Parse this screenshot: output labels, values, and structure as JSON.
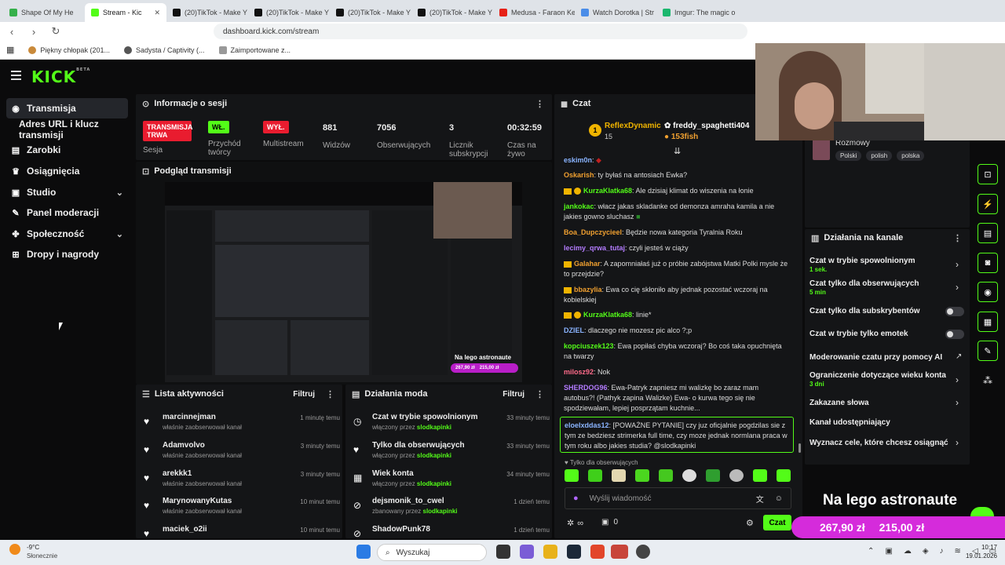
{
  "browser": {
    "tabs": [
      {
        "title": "Shape Of My He",
        "color": "#35b04a"
      },
      {
        "title": "Stream - Kic",
        "color": "#53fc18",
        "active": true
      },
      {
        "title": "(20)TikTok - Make Y",
        "color": "#111111"
      },
      {
        "title": "(20)TikTok - Make Y",
        "color": "#111111"
      },
      {
        "title": "(20)TikTok - Make Y",
        "color": "#111111"
      },
      {
        "title": "(20)TikTok - Make Y",
        "color": "#111111"
      },
      {
        "title": "Medusa - Faraon Ke",
        "color": "#e62117"
      },
      {
        "title": "Watch Dorotka | Str",
        "color": "#4a8de8"
      },
      {
        "title": "Imgur: The magic o",
        "color": "#1bb76e"
      }
    ],
    "url": "dashboard.kick.com/stream",
    "bookmarks": [
      "Piękny chłopak (201...",
      "Sadysta / Captivity (...",
      "Zaimportowane z..."
    ]
  },
  "sidebar": {
    "items": [
      {
        "label": "Transmisja",
        "icon": "broadcast-icon"
      },
      {
        "label": "Adres URL i klucz transmisji"
      },
      {
        "label": "Zarobki",
        "icon": "wallet-icon"
      },
      {
        "label": "Osiągnięcia",
        "icon": "trophy-icon"
      },
      {
        "label": "Studio",
        "icon": "studio-icon"
      },
      {
        "label": "Panel moderacji",
        "icon": "wrench-icon"
      },
      {
        "label": "Społeczność",
        "icon": "community-icon"
      },
      {
        "label": "Dropy i nagrody",
        "icon": "drops-icon"
      }
    ]
  },
  "session": {
    "title": "Informacje o sesji",
    "status_badge": "TRANSMISJA TRWA",
    "status_label": "Sesja",
    "stream_on_badge": "WŁ.",
    "stream_on_label": "Przychód twórcy",
    "multistream_badge": "WYŁ.",
    "multistream_label": "Multistream",
    "viewers_value": "881",
    "viewers_label": "Widzów",
    "followers_value": "7056",
    "followers_label": "Obserwujących",
    "subs_value": "3",
    "subs_label": "Licznik subskrypcji",
    "time_value": "00:32:59",
    "time_label": "Czas na żywo"
  },
  "preview": {
    "title": "Podgląd transmisji",
    "overlay": "Na lego astronaute",
    "amount1": "267,90 zł",
    "amount2": "215,00 zł"
  },
  "activity": {
    "title": "Lista aktywności",
    "filter": "Filtruj",
    "items": [
      {
        "name": "marcinnejman",
        "sub": "właśnie zaobserwował kanał",
        "time": "1 minutę temu"
      },
      {
        "name": "Adamvolvo",
        "sub": "właśnie zaobserwował kanał",
        "time": "3 minuty temu"
      },
      {
        "name": "arekkk1",
        "sub": "właśnie zaobserwował kanał",
        "time": "3 minuty temu"
      },
      {
        "name": "MarynowanyKutas",
        "sub": "właśnie zaobserwował kanał",
        "time": "10 minut temu"
      },
      {
        "name": "maciek_o2ii",
        "sub": "",
        "time": "10 minut temu"
      }
    ]
  },
  "modlog": {
    "title": "Działania moda",
    "filter": "Filtruj",
    "items": [
      {
        "name": "Czat w trybie spowolnionym",
        "by": "włączony przez",
        "mod": "slodkapinki",
        "time": "33 minuty temu"
      },
      {
        "name": "Tylko dla obserwujących",
        "by": "włączony przez",
        "mod": "slodkapinki",
        "time": "33 minuty temu"
      },
      {
        "name": "Wiek konta",
        "by": "włączony przez",
        "mod": "slodkapinki",
        "time": "34 minuty temu"
      },
      {
        "name": "dejsmonik_to_cwel",
        "by": "zbanowany przez",
        "mod": "slodkapinki",
        "time": "1 dzień temu"
      },
      {
        "name": "ShadowPunk78",
        "by": "",
        "mod": "",
        "time": "1 dzień temu"
      }
    ]
  },
  "chat": {
    "title": "Czat",
    "top_gifter1": "ReflexDynamic",
    "top_gifter1_count": "15",
    "top_gifter2": "freddy_spaghetti404",
    "top_gifter2_amount": "153fish",
    "messages": [
      {
        "user": "eskim0n",
        "color": "#8ab4ff",
        "text": ""
      },
      {
        "user": "Oskarish",
        "color": "#f0a030",
        "text": "ty byłaś na antosiach Ewka?"
      },
      {
        "user": "KurzaKlatka68",
        "color": "#53fc18",
        "text": "Ale dzisiaj klimat do wiszenia na łonie",
        "badges": true
      },
      {
        "user": "jankokac",
        "color": "#53fc18",
        "text": "włacz jakas skladanke od demonza amraha kamila a nie jakies gowno sluchasz"
      },
      {
        "user": "Boa_Dupczycieel",
        "color": "#f0a030",
        "text": "Będzie nowa kategoria Tyralnia Roku"
      },
      {
        "user": "lecimy_qrwa_tutaj",
        "color": "#b47cff",
        "text": "czyli jesteś w ciąży"
      },
      {
        "user": "Galahar",
        "color": "#f0a030",
        "text": "A zapomniałaś już o próbie zabójstwa Matki Polki mysle że to przejdzie?",
        "crown": true
      },
      {
        "user": "bbazylia",
        "color": "#f0a030",
        "text": "Ewa co cię skłoniło aby jednak pozostać wczoraj na kobielskiej",
        "crown": true
      },
      {
        "user": "KurzaKlatka68",
        "color": "#53fc18",
        "text": "linie*",
        "badges": true
      },
      {
        "user": "DZIEL",
        "color": "#8ab4ff",
        "text": "dlaczego nie mozesz pic alco ?;p"
      },
      {
        "user": "kopciuszek123",
        "color": "#53fc18",
        "text": "Ewa popiłaś chyba wczoraj? Bo coś taka opuchnięta na twarzy"
      },
      {
        "user": "milosz92",
        "color": "#ff6b8a",
        "text": "Nok"
      },
      {
        "user": "SHERDOG96",
        "color": "#b47cff",
        "text": "Ewa-Patryk zapniesz mi walizkę bo zaraz mam autobus?! (Pathyk zapina Walizke) Ewa- o kurwa tego się nie spodziewałam, lepiej posprzątam kuchnie..."
      }
    ],
    "highlight_user": "eloelxddas12",
    "highlight_text": "[POWAŻNE PYTANIE] czy juz oficjalnie pogdzilas sie z tym ze bedziesz strimerka full time, czy moze jednak normlana praca w tym roku albo jakies studia? @slodkapinki",
    "followers_only": "Tylko dla obserwujących",
    "input_placeholder": "Wyślij wiadomość",
    "points": "∞",
    "drops": "0",
    "send": "Czat"
  },
  "channel_info": {
    "title": "Rozmowy",
    "tags": [
      "Polski",
      "polish",
      "polska"
    ]
  },
  "channel_actions": {
    "title": "Działania na kanale",
    "items": [
      {
        "label": "Czat w trybie spowolnionym",
        "sub": "1 sek.",
        "control": "chevron"
      },
      {
        "label": "Czat tylko dla obserwujących",
        "sub": "5 min",
        "control": "chevron"
      },
      {
        "label": "Czat tylko dla subskrybentów",
        "sub": "",
        "control": "toggle"
      },
      {
        "label": "Czat w trybie tylko emotek",
        "sub": "",
        "control": "toggle"
      },
      {
        "label": "Moderowanie czatu przy pomocy AI",
        "sub": "",
        "control": "external"
      },
      {
        "label": "Ograniczenie dotyczące wieku konta",
        "sub": "3 dni",
        "control": "chevron"
      },
      {
        "label": "Zakazane słowa",
        "sub": "",
        "control": "chevron"
      },
      {
        "label": "Kanał udostępniający",
        "sub": "",
        "control": "none"
      },
      {
        "label": "Wyznacz cele, które chcesz osiągnąć",
        "sub": "",
        "control": "chevron"
      }
    ]
  },
  "overlay": {
    "text": "Na lego astronaute",
    "amount1": "267,90 zł",
    "amount2": "215,00 zł"
  },
  "taskbar": {
    "weather_temp": "-9°C",
    "weather_desc": "Słonecznie",
    "search": "Wyszukaj",
    "time": "10:17",
    "date": "19.01.2026"
  }
}
